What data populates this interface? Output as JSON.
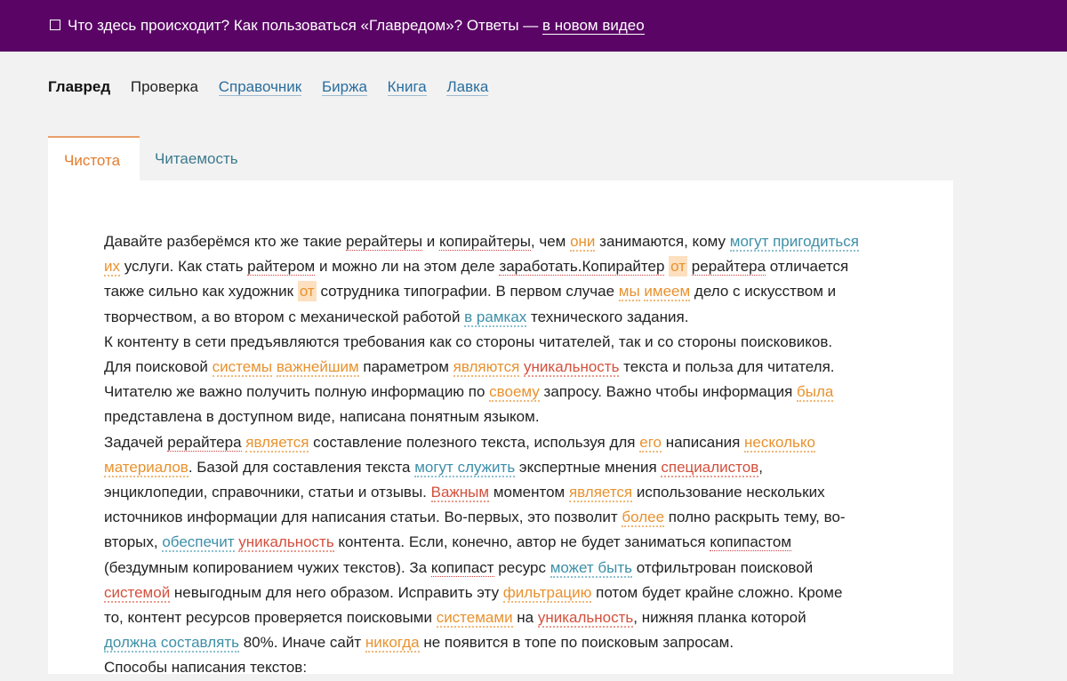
{
  "banner": {
    "icon": "checkbox-icon",
    "text": "Что здесь происходит? Как пользоваться «Главредом»? Ответы — ",
    "link": "в новом видео"
  },
  "nav": {
    "brand": "Главред",
    "items": [
      "Проверка",
      "Справочник",
      "Биржа",
      "Книга",
      "Лавка"
    ]
  },
  "tabs": [
    "Чистота",
    "Читаемость"
  ],
  "colors": {
    "banner_bg": "#5a0566",
    "accent_orange": "#e8922e",
    "accent_red": "#d4503c",
    "accent_blue": "#3d8fa8",
    "link": "#2a6e9e"
  },
  "article": [
    "Давайте разберёмся кто же такие [u:рерайтеры] и [u:копирайтеры], чем [o:они] занимаются, кому [b:могут пригодиться]",
    "[o:их] услуги. Как стать [u:райтером] и можно ли на этом деле [u:заработать.Копирайтер] [h:от] [u:рерайтера] отличается",
    "также сильно как художник [h:от] сотрудника типографии. В первом случае [o:мы] [o:имеем] дело с искусством и",
    "творчеством, а во втором с механической работой [b:в рамках] технического задания.",
    "К контенту в сети предъявляются требования как со стороны читателей, так и со стороны поисковиков.",
    "Для поисковой [o:системы] [o:важнейшим] параметром [o:являются] [r:уникальность] текста и польза для читателя.",
    "Читателю же важно получить полную информацию по [o:своему] запросу. Важно чтобы информация [o:была]",
    "представлена в доступном виде, написана понятным языком.",
    "Задачей [u:рерайтера] [o:является] составление полезного текста, используя для [o:его] написания [o:несколько]",
    "[o:материалов]. Базой для составления текста [b:могут служить] экспертные мнения [r:специалистов],",
    "энциклопедии, справочники, статьи и отзывы. [r:Важным] моментом [o:является] использование нескольких",
    "источников информации для написания статьи. Во-первых, это позволит [o:более] полно раскрыть тему, во-",
    "вторых, [b:обеспечит] [r:уникальность] контента. Если, конечно, автор не будет заниматься [u:копипастом]",
    "(бездумным копированием чужих текстов). За [u:копипаст] ресурс [b:может быть] отфильтрован поисковой",
    "[r:системой] невыгодным для него образом. Исправить эту [o:фильтрацию] потом будет крайне сложно. Кроме",
    "то, контент ресурсов проверяется поисковыми [o:системами] на [r:уникальность], нижняя планка которой",
    "[b:должна составлять] 80%. Иначе сайт [o:никогда] не появится в топе по поисковым запросам.",
    "Способы написания текстов:"
  ]
}
